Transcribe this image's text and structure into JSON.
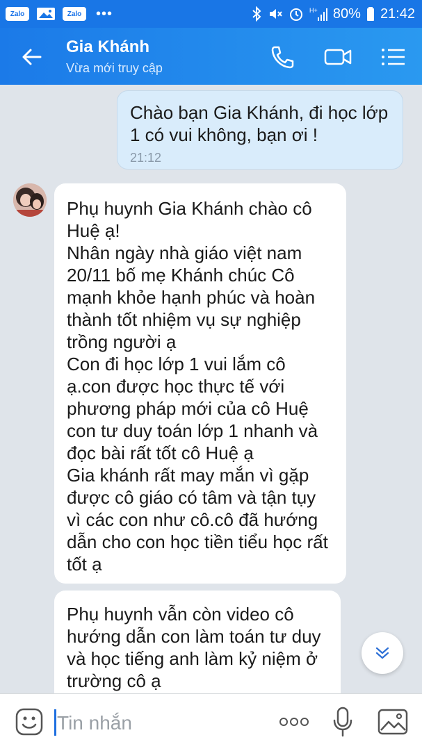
{
  "status_bar": {
    "apps": [
      "Zalo",
      "Zalo"
    ],
    "dots": "•••",
    "battery": "80%",
    "time": "21:42"
  },
  "header": {
    "title": "Gia Khánh",
    "subtitle": "Vừa mới truy cập",
    "icons": [
      "back-arrow-icon",
      "phone-icon",
      "video-call-icon",
      "menu-icon"
    ]
  },
  "messages": [
    {
      "direction": "outgoing",
      "lines": [
        "Chào bạn Gia Khánh, đi học lớp",
        "1 có vui không, bạn ơi !"
      ],
      "time": "21:12"
    },
    {
      "direction": "incoming",
      "lines": [
        "Phụ huynh Gia Khánh chào cô",
        "Huệ ạ!",
        "Nhân ngày nhà giáo việt nam",
        "20/11 bố mẹ Khánh chúc Cô",
        "mạnh khỏe hạnh phúc và hoàn",
        "thành tốt nhiệm vụ sự nghiệp",
        "trồng người ạ",
        "Con đi học lớp 1 vui lắm cô",
        "ạ.con được học thực tế với",
        "phương pháp mới của cô Huệ",
        "con tư duy toán lớp 1 nhanh và",
        "đọc bài rất tốt cô Huệ ạ",
        "Gia khánh rất may mắn vì gặp",
        "được cô giáo có tâm và tận tụy",
        "vì các con như cô.cô đã hướng",
        "dẫn cho con học tiền tiểu học rất",
        "tốt ạ"
      ]
    },
    {
      "direction": "incoming",
      "lines": [
        "Phụ huynh vẫn còn video cô",
        "hướng dẫn con làm toán tư duy",
        "và học tiếng anh làm kỷ niệm ở",
        "trường cô ạ"
      ]
    }
  ],
  "input": {
    "placeholder": "Tin nhắn",
    "icons": [
      "emoji-icon",
      "more-icon",
      "microphone-icon",
      "gallery-icon"
    ]
  },
  "colors": {
    "header": "#1b7ae8",
    "outgoing_bubble": "#d9ecfb",
    "incoming_bubble": "#ffffff",
    "background": "#dfe4ea"
  }
}
